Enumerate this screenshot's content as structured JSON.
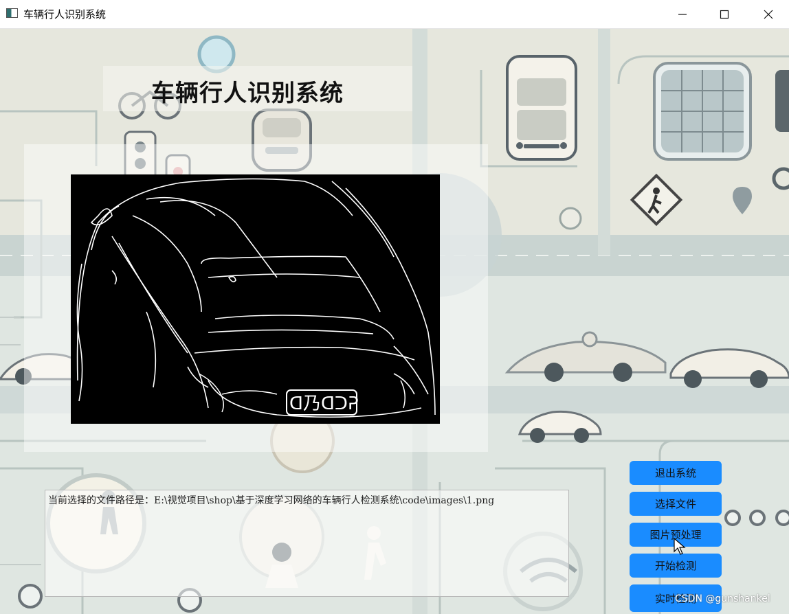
{
  "window": {
    "title": "车辆行人识别系统"
  },
  "header": {
    "title": "车辆行人识别系统"
  },
  "path_box": {
    "text": "当前选择的文件路径是：E:\\视觉项目\\shop\\基于深度学习网络的车辆行人检测系统\\code\\images\\1.png"
  },
  "buttons": {
    "exit": "退出系统",
    "select_file": "选择文件",
    "preprocess": "图片预处理",
    "start_detect": "开始检测",
    "realtime_detect": "实时检测"
  },
  "image_plate_text": "ᗡ乃ᗡᑐᕈ",
  "watermark": "CSDN @gunshankel",
  "colors": {
    "button_bg": "#1a8cff",
    "image_bg": "#000000",
    "scene_bg": "#d9e3df"
  },
  "icons": {
    "app": "app-window-icon",
    "minimize": "minimize-icon",
    "maximize": "maximize-icon",
    "close": "close-icon",
    "cursor": "mouse-pointer-icon"
  }
}
